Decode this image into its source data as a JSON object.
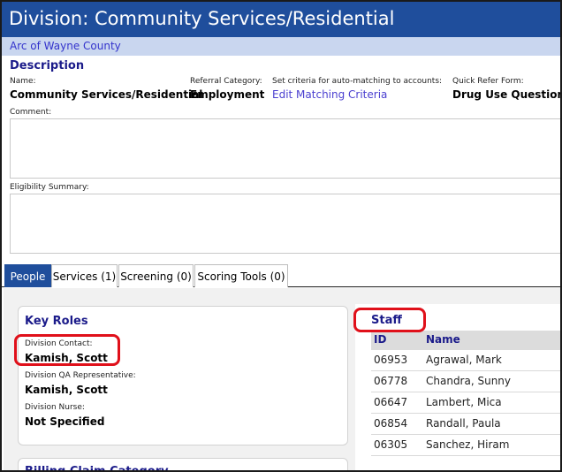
{
  "window": {
    "title": "Division: Community Services/Residential"
  },
  "organization": {
    "name": "Arc of Wayne County"
  },
  "description": {
    "heading": "Description",
    "name_label": "Name:",
    "name_value": "Community Services/Residential",
    "referral_category_label": "Referral Category:",
    "referral_category_value": "Employment",
    "auto_match_label": "Set criteria for auto-matching to accounts:",
    "auto_match_link": "Edit Matching Criteria",
    "quick_refer_label": "Quick Refer Form:",
    "quick_refer_value": "Drug Use Questionn",
    "comment_label": "Comment:",
    "eligibility_label": "Eligibility Summary:"
  },
  "tabs": [
    {
      "label": "People",
      "active": true
    },
    {
      "label": "Services (1)",
      "active": false
    },
    {
      "label": "Screening (0)",
      "active": false
    },
    {
      "label": "Scoring Tools (0)",
      "active": false
    }
  ],
  "key_roles": {
    "title": "Key Roles",
    "roles": [
      {
        "label": "Division Contact:",
        "value": "Kamish, Scott"
      },
      {
        "label": "Division QA Representative:",
        "value": "Kamish, Scott"
      },
      {
        "label": "Division Nurse:",
        "value": "Not Specified"
      }
    ]
  },
  "billing": {
    "title": "Billing Claim Category"
  },
  "staff": {
    "title": "Staff",
    "columns": [
      "ID",
      "Name"
    ],
    "rows": [
      {
        "id": "06953",
        "name": "Agrawal, Mark"
      },
      {
        "id": "06778",
        "name": "Chandra, Sunny"
      },
      {
        "id": "06647",
        "name": "Lambert, Mica"
      },
      {
        "id": "06854",
        "name": "Randall, Paula"
      },
      {
        "id": "06305",
        "name": "Sanchez, Hiram"
      }
    ]
  },
  "colors": {
    "title_bar": "#1f4e9c",
    "org_bar": "#c9d6ef",
    "heading_text": "#1b1b8a",
    "link_text": "#4a3fd0",
    "highlight": "#e0101a"
  }
}
